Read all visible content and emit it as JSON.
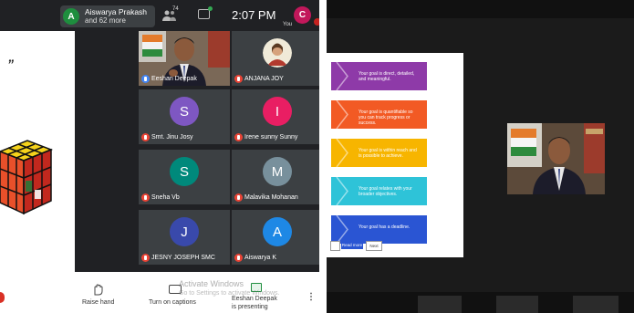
{
  "left_screen": {
    "host_chip": {
      "avatar_letter": "A",
      "name": "Aiswarya Prakash",
      "more": "and 62 more"
    },
    "people_count": "74",
    "time": "2:07 PM",
    "self": {
      "avatar_letter": "C",
      "label": "You"
    },
    "slide": {
      "quote_mark": "”"
    },
    "participants": [
      {
        "name": "Eeshan Deepak",
        "letter": "",
        "color": "",
        "video": true
      },
      {
        "name": "ANJANA JOY",
        "letter": "",
        "color": "#d9c0a8",
        "video": false
      },
      {
        "name": "Smt. Jinu Josy",
        "letter": "S",
        "color": "#7e57c2",
        "video": false
      },
      {
        "name": "Irene sunny Sunny",
        "letter": "I",
        "color": "#e91e63",
        "video": false
      },
      {
        "name": "Sneha Vb",
        "letter": "S",
        "color": "#00897b",
        "video": false
      },
      {
        "name": "Malavika Mohanan",
        "letter": "M",
        "color": "#78909c",
        "video": false
      },
      {
        "name": "JESNY JOSEPH SMC",
        "letter": "J",
        "color": "#3949ab",
        "video": false
      },
      {
        "name": "Aiswarya K",
        "letter": "A",
        "color": "#1e88e5",
        "video": false
      }
    ],
    "bottom_bar": {
      "raise_hand": "Raise hand",
      "captions": "Turn on captions",
      "presenting": "Eeshan Deepak\nis presenting",
      "watermark_title": "Activate Windows",
      "watermark_sub": "Go to Settings to activate Windows."
    }
  },
  "right_screen": {
    "steps": [
      {
        "text": "Your goal is direct, detailed, and meaningful.",
        "color": "#8e3aa8"
      },
      {
        "text": "Your goal is quantifiable so you can track progress or success.",
        "color": "#f25a24"
      },
      {
        "text": "Your goal is within reach and is possible to achieve.",
        "color": "#f7b500"
      },
      {
        "text": "Your goal relates with your broader objectives.",
        "color": "#2ec3d8"
      },
      {
        "text": "Your goal has a deadline.",
        "color": "#2a55d3"
      }
    ],
    "buttons": [
      "",
      "Read more",
      "Next"
    ]
  }
}
